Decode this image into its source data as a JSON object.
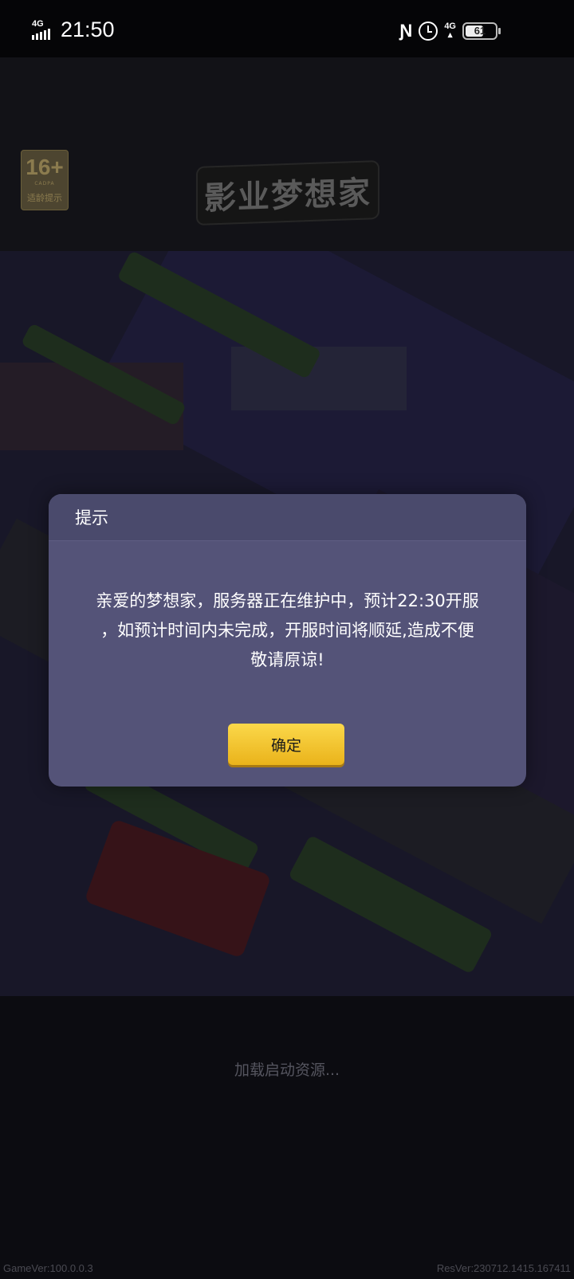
{
  "status_bar": {
    "network": "4G",
    "time": "21:50",
    "nfc_icon": "nfc-icon",
    "alarm_icon": "alarm-icon",
    "network_right": "4G",
    "battery": "61",
    "battery_level": 0.61
  },
  "header": {
    "age_rating": "16+",
    "age_org": "CADPA",
    "age_tip": "适龄提示",
    "logo_text": "影业梦想家"
  },
  "dialog": {
    "title": "提示",
    "message_line1": "亲爱的梦想家，服务器正在维护中，预计22:30开服",
    "message_line2": "，如预计时间内未完成，开服时间将顺延,造成不便",
    "message_line3": "敬请原谅!",
    "confirm_label": "确定"
  },
  "loading_text": "加载启动资源...",
  "footer": {
    "game_version": "GameVer:100.0.0.3",
    "res_version": "ResVer:230712.1415.167411"
  },
  "colors": {
    "dialog_bg": "#545378",
    "button": "#f5c935"
  }
}
